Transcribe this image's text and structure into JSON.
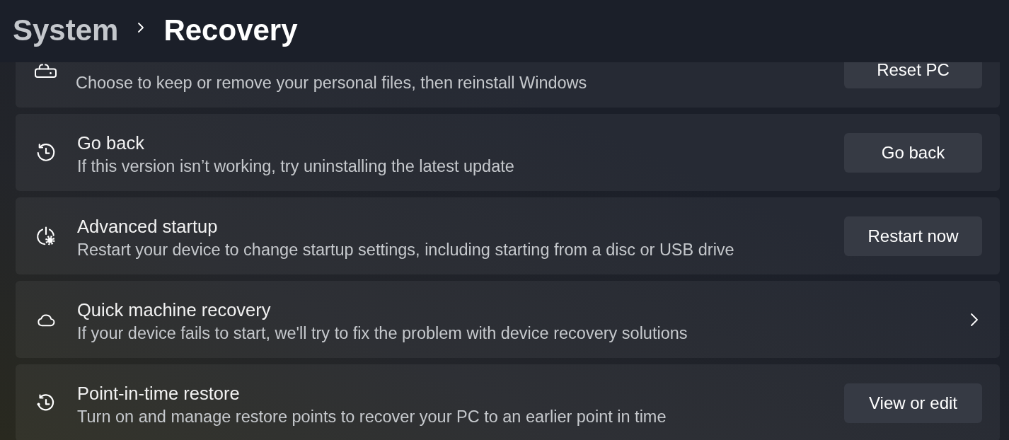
{
  "header": {
    "breadcrumb": [
      {
        "label": "System",
        "selected": false
      },
      {
        "label": "Recovery",
        "selected": true
      }
    ]
  },
  "settings": [
    {
      "kind": "button",
      "description": "Choose to keep or remove your personal files, then reinstall Windows",
      "button": "Reset PC"
    },
    {
      "kind": "button",
      "title": "Go back",
      "description": "If this version isn’t working, try uninstalling the latest update",
      "button": "Go back"
    },
    {
      "kind": "button",
      "title": "Advanced startup",
      "description": "Restart your device to change startup settings, including starting from a disc or USB drive",
      "button": "Restart now"
    },
    {
      "kind": "link",
      "title": "Quick machine recovery",
      "description": "If your device fails to start, we'll try to fix the problem with device recovery solutions"
    },
    {
      "kind": "button",
      "title": "Point-in-time restore",
      "description": "Turn on and manage restore points to recover your PC to an earlier point in time",
      "button": "View or edit"
    }
  ]
}
